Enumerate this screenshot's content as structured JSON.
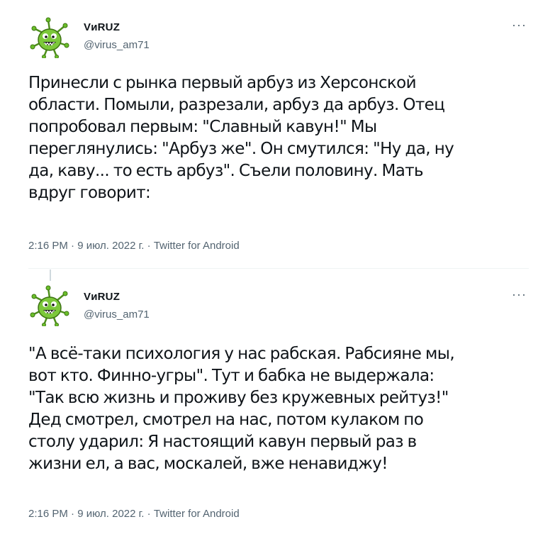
{
  "tweets": [
    {
      "author_name": "VиRUZ",
      "author_handle": "@virus_am71",
      "more_label": "···",
      "text_lines": [
        "Принесли с рынка первый арбуз из Херсонской",
        "области. Помыли, разрезали, арбуз да арбуз. Отец",
        "попробовал первым: \"Славный кавун!\" Мы",
        "переглянулись: \"Арбуз же\". Он смутился: \"Ну да, ну",
        "да, каву... то есть арбуз\". Съели половину. Мать",
        "вдруг говорит:"
      ],
      "time": "2:16 PM",
      "sep": " · ",
      "date": "9 июл. 2022 г.",
      "source": "Twitter for Android"
    },
    {
      "author_name": "VиRUZ",
      "author_handle": "@virus_am71",
      "more_label": "···",
      "text_lines": [
        "\"А всё-таки психология у нас рабская. Рабсияне мы,",
        "вот кто. Финно-угры\". Тут и бабка не выдержала:",
        "\"Так всю жизнь и проживу без кружевных рейтуз!\"",
        "Дед смотрел, смотрел на нас, потом кулаком по",
        "столу ударил: Я настоящий кавун первый раз в",
        "жизни ел, а вас, москалей, вже ненавиджу!"
      ],
      "time": "2:16 PM",
      "sep": " · ",
      "date": "9 июл. 2022 г.",
      "source": "Twitter for Android"
    }
  ],
  "colors": {
    "text": "#0f1419",
    "secondary": "#536471",
    "divider": "#eff3f4",
    "avatar_green": "#6bbf2a"
  },
  "icons": {
    "avatar": "green-virus-avatar-icon",
    "more": "more-dots-icon"
  }
}
